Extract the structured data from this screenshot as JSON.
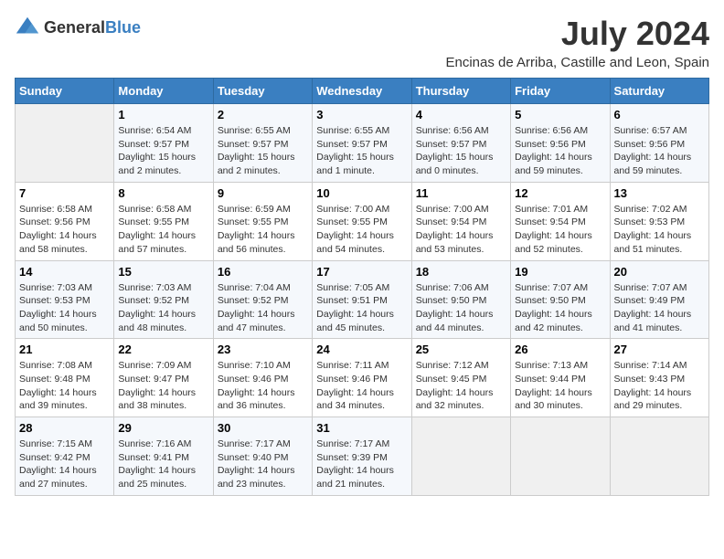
{
  "logo": {
    "general": "General",
    "blue": "Blue"
  },
  "title": {
    "month_year": "July 2024",
    "location": "Encinas de Arriba, Castille and Leon, Spain"
  },
  "headers": [
    "Sunday",
    "Monday",
    "Tuesday",
    "Wednesday",
    "Thursday",
    "Friday",
    "Saturday"
  ],
  "weeks": [
    [
      {
        "day": "",
        "info": ""
      },
      {
        "day": "1",
        "info": "Sunrise: 6:54 AM\nSunset: 9:57 PM\nDaylight: 15 hours\nand 2 minutes."
      },
      {
        "day": "2",
        "info": "Sunrise: 6:55 AM\nSunset: 9:57 PM\nDaylight: 15 hours\nand 2 minutes."
      },
      {
        "day": "3",
        "info": "Sunrise: 6:55 AM\nSunset: 9:57 PM\nDaylight: 15 hours\nand 1 minute."
      },
      {
        "day": "4",
        "info": "Sunrise: 6:56 AM\nSunset: 9:57 PM\nDaylight: 15 hours\nand 0 minutes."
      },
      {
        "day": "5",
        "info": "Sunrise: 6:56 AM\nSunset: 9:56 PM\nDaylight: 14 hours\nand 59 minutes."
      },
      {
        "day": "6",
        "info": "Sunrise: 6:57 AM\nSunset: 9:56 PM\nDaylight: 14 hours\nand 59 minutes."
      }
    ],
    [
      {
        "day": "7",
        "info": "Sunrise: 6:58 AM\nSunset: 9:56 PM\nDaylight: 14 hours\nand 58 minutes."
      },
      {
        "day": "8",
        "info": "Sunrise: 6:58 AM\nSunset: 9:55 PM\nDaylight: 14 hours\nand 57 minutes."
      },
      {
        "day": "9",
        "info": "Sunrise: 6:59 AM\nSunset: 9:55 PM\nDaylight: 14 hours\nand 56 minutes."
      },
      {
        "day": "10",
        "info": "Sunrise: 7:00 AM\nSunset: 9:55 PM\nDaylight: 14 hours\nand 54 minutes."
      },
      {
        "day": "11",
        "info": "Sunrise: 7:00 AM\nSunset: 9:54 PM\nDaylight: 14 hours\nand 53 minutes."
      },
      {
        "day": "12",
        "info": "Sunrise: 7:01 AM\nSunset: 9:54 PM\nDaylight: 14 hours\nand 52 minutes."
      },
      {
        "day": "13",
        "info": "Sunrise: 7:02 AM\nSunset: 9:53 PM\nDaylight: 14 hours\nand 51 minutes."
      }
    ],
    [
      {
        "day": "14",
        "info": "Sunrise: 7:03 AM\nSunset: 9:53 PM\nDaylight: 14 hours\nand 50 minutes."
      },
      {
        "day": "15",
        "info": "Sunrise: 7:03 AM\nSunset: 9:52 PM\nDaylight: 14 hours\nand 48 minutes."
      },
      {
        "day": "16",
        "info": "Sunrise: 7:04 AM\nSunset: 9:52 PM\nDaylight: 14 hours\nand 47 minutes."
      },
      {
        "day": "17",
        "info": "Sunrise: 7:05 AM\nSunset: 9:51 PM\nDaylight: 14 hours\nand 45 minutes."
      },
      {
        "day": "18",
        "info": "Sunrise: 7:06 AM\nSunset: 9:50 PM\nDaylight: 14 hours\nand 44 minutes."
      },
      {
        "day": "19",
        "info": "Sunrise: 7:07 AM\nSunset: 9:50 PM\nDaylight: 14 hours\nand 42 minutes."
      },
      {
        "day": "20",
        "info": "Sunrise: 7:07 AM\nSunset: 9:49 PM\nDaylight: 14 hours\nand 41 minutes."
      }
    ],
    [
      {
        "day": "21",
        "info": "Sunrise: 7:08 AM\nSunset: 9:48 PM\nDaylight: 14 hours\nand 39 minutes."
      },
      {
        "day": "22",
        "info": "Sunrise: 7:09 AM\nSunset: 9:47 PM\nDaylight: 14 hours\nand 38 minutes."
      },
      {
        "day": "23",
        "info": "Sunrise: 7:10 AM\nSunset: 9:46 PM\nDaylight: 14 hours\nand 36 minutes."
      },
      {
        "day": "24",
        "info": "Sunrise: 7:11 AM\nSunset: 9:46 PM\nDaylight: 14 hours\nand 34 minutes."
      },
      {
        "day": "25",
        "info": "Sunrise: 7:12 AM\nSunset: 9:45 PM\nDaylight: 14 hours\nand 32 minutes."
      },
      {
        "day": "26",
        "info": "Sunrise: 7:13 AM\nSunset: 9:44 PM\nDaylight: 14 hours\nand 30 minutes."
      },
      {
        "day": "27",
        "info": "Sunrise: 7:14 AM\nSunset: 9:43 PM\nDaylight: 14 hours\nand 29 minutes."
      }
    ],
    [
      {
        "day": "28",
        "info": "Sunrise: 7:15 AM\nSunset: 9:42 PM\nDaylight: 14 hours\nand 27 minutes."
      },
      {
        "day": "29",
        "info": "Sunrise: 7:16 AM\nSunset: 9:41 PM\nDaylight: 14 hours\nand 25 minutes."
      },
      {
        "day": "30",
        "info": "Sunrise: 7:17 AM\nSunset: 9:40 PM\nDaylight: 14 hours\nand 23 minutes."
      },
      {
        "day": "31",
        "info": "Sunrise: 7:17 AM\nSunset: 9:39 PM\nDaylight: 14 hours\nand 21 minutes."
      },
      {
        "day": "",
        "info": ""
      },
      {
        "day": "",
        "info": ""
      },
      {
        "day": "",
        "info": ""
      }
    ]
  ]
}
